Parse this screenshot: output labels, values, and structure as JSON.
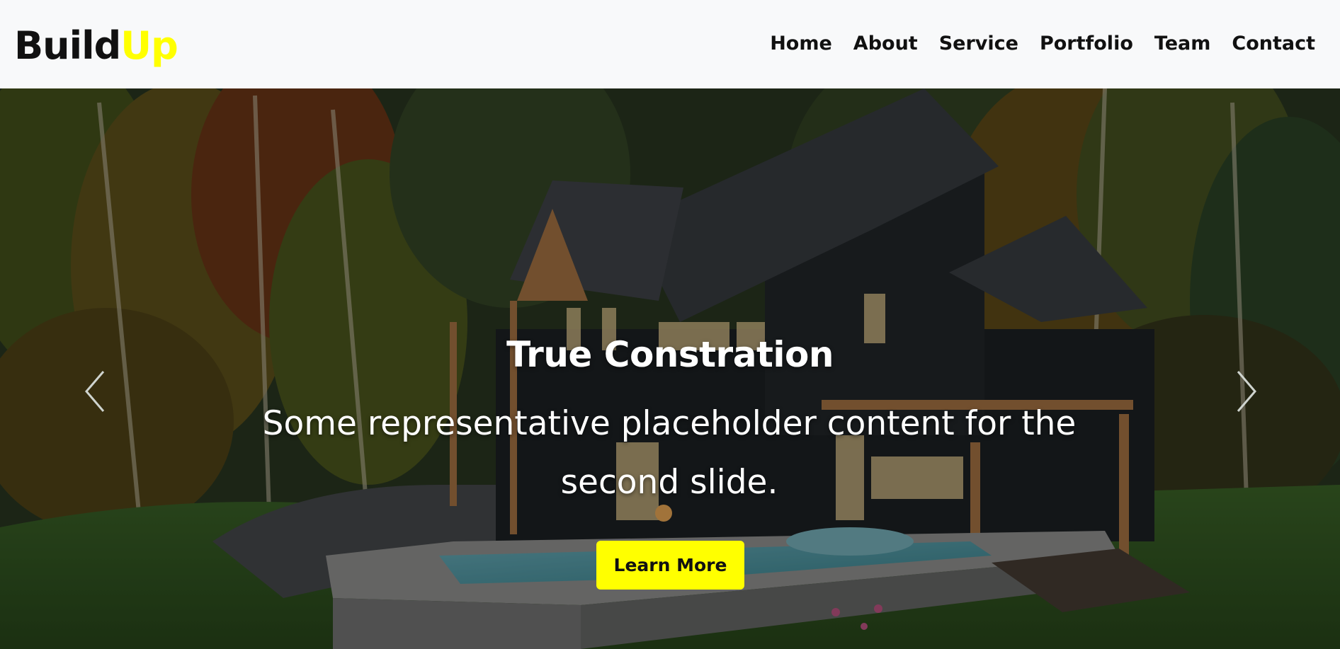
{
  "brand": {
    "part1": "Build",
    "part2": "Up"
  },
  "nav": {
    "items": [
      {
        "label": "Home"
      },
      {
        "label": "About"
      },
      {
        "label": "Service"
      },
      {
        "label": "Portfolio"
      },
      {
        "label": "Team"
      },
      {
        "label": "Contact"
      }
    ]
  },
  "hero": {
    "title": "True Constration",
    "text": "Some representative placeholder content for the second slide.",
    "button_label": "Learn More",
    "prev_icon": "chevron-left-icon",
    "next_icon": "chevron-right-icon"
  },
  "colors": {
    "accent": "#ffff00",
    "navbar_bg": "#f8f9fa",
    "text_dark": "#111111",
    "text_light": "#ffffff"
  }
}
